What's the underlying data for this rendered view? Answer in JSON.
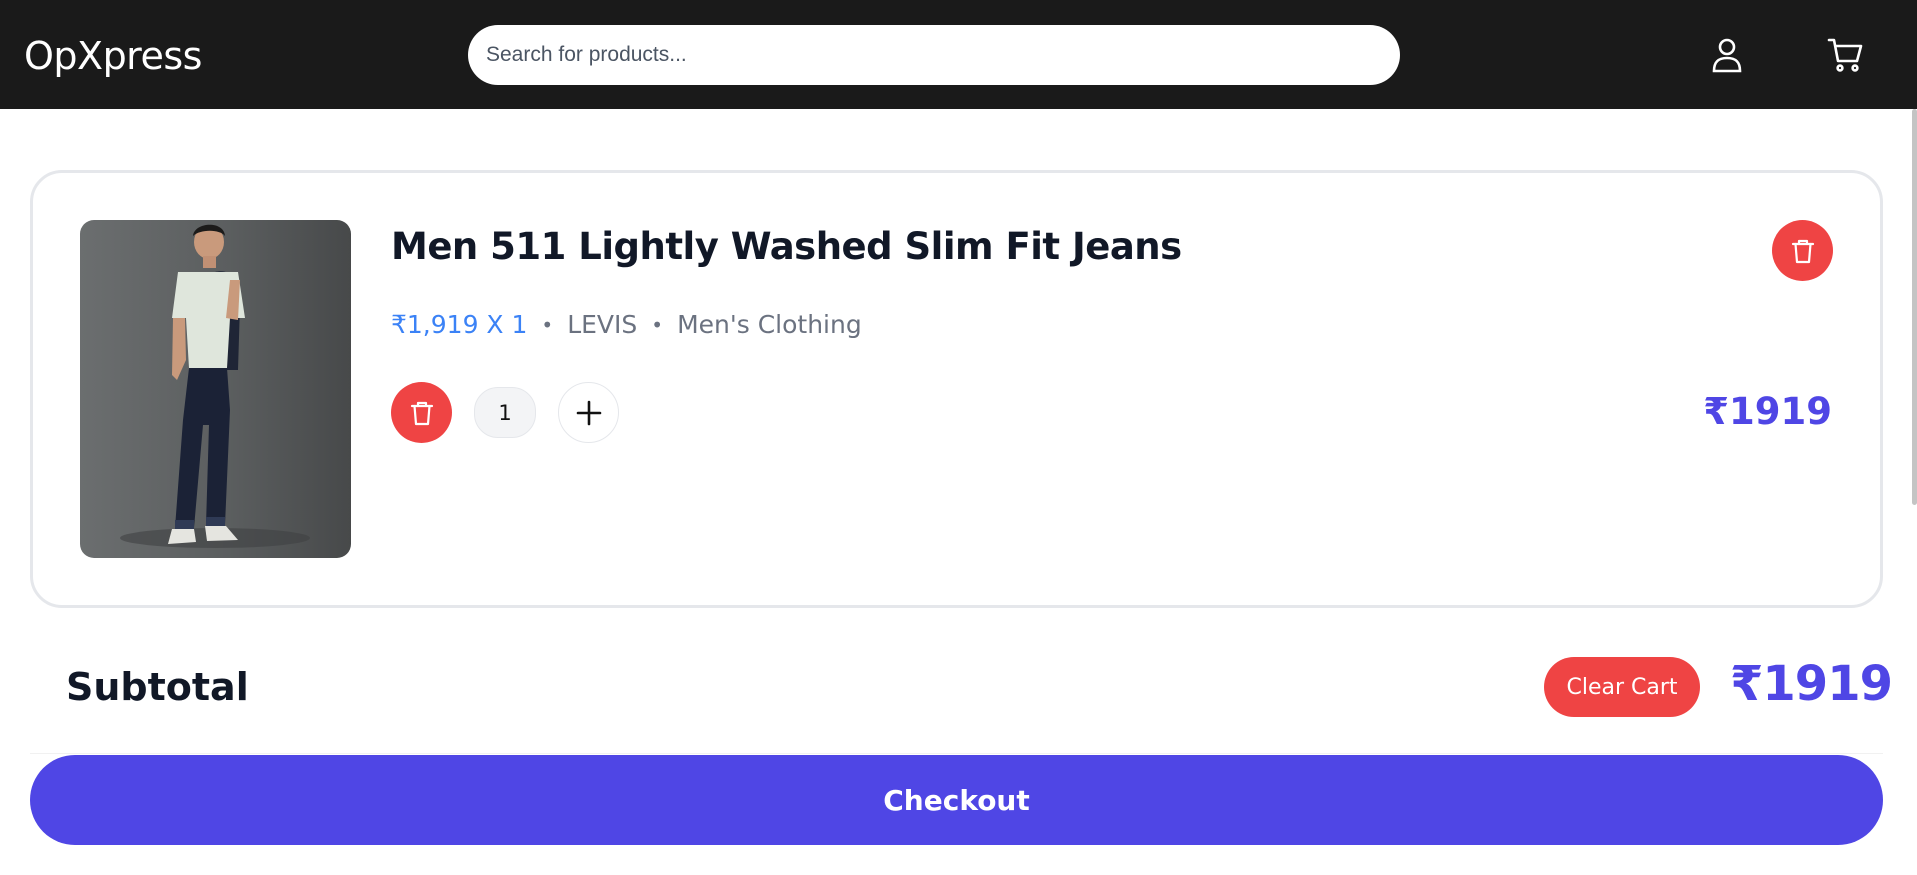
{
  "header": {
    "brand": "OpXpress",
    "search_placeholder": "Search for products...",
    "user_icon": "user-icon",
    "cart_icon": "cart-icon"
  },
  "cart": {
    "items": [
      {
        "title": "Men 511 Lightly Washed Slim Fit Jeans",
        "price_qty": "₹1,919 X 1",
        "brand": "LEVIS",
        "category": "Men's Clothing",
        "quantity": "1",
        "line_total": "₹1919",
        "image_alt": "product-image"
      }
    ],
    "subtotal_label": "Subtotal",
    "clear_label": "Clear Cart",
    "subtotal_value": "₹1919",
    "checkout_label": "Checkout"
  },
  "colors": {
    "header_bg": "#1a1a1a",
    "accent": "#4f46e5",
    "price_blue": "#3b82f6",
    "danger": "#ef4444"
  }
}
